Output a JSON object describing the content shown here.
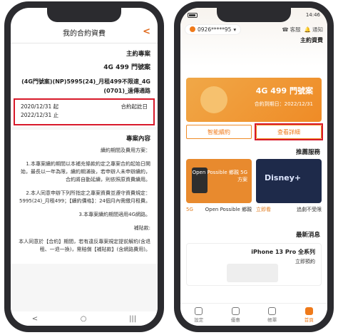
{
  "left": {
    "back_glyph": "<",
    "title": "我的合約資費",
    "section_main": "主約專案",
    "plan_name": "4G 499 門號案",
    "plan_desc": "(4G門號案)(NP)5995(24)_月租499不限速_4G (0701)_遠傳通路",
    "contract_label": "合約起訖日",
    "contract_start": "2020/12/31 起",
    "contract_end": "2022/12/31 止",
    "section_content": "專案內容",
    "para1": "續約期間及費用方案：",
    "para2": "1.本專案續約期間以本補充條款約定之專案合約起始日開始，最長以一年為限，續約期滿後，若申辦人未申辦續約，合約將自動延續，則依照原資費續用。",
    "para3": "2.本人同意申辦下列所指定之專案資費並遵守資費規定：5995(24)_月租499；【續約價格】：24個月內需繳月租費。",
    "para4": "3.本專案續約期間適用4G網路。",
    "para5": "補貼款:",
    "para6": "本人同意於【合約】期間，若有違反專案規定提前解約(含退租、一退一換)，需賠償【補貼款】(含網路費用)。",
    "home_back": "<",
    "home_menu": "|||",
    "home_circle": "○"
  },
  "right": {
    "time": "14:46",
    "account": "0926*****95",
    "chevron": "▾",
    "tool_service": "客服",
    "tool_notify": "通知",
    "contract_label": "主約資費",
    "banner_plan": "4G 499 門號案",
    "banner_date": "合約到期日：2022/12/31",
    "btn_detail": "查看詳細",
    "btn_renew": "智能續約",
    "recs_title": "推薦服務",
    "card_dark_logo": "Disney+",
    "card_orange_text": "Open Possible 鄉親\n5G 方案",
    "rec_label1": "追劇不受限",
    "rec_label1_action": "立即看",
    "rec_label2": "Open Possible 鄉親",
    "rec_label2_action": "5G",
    "news_title": "最新消息",
    "news_head": "iPhone 13 Pro 全系列",
    "news_sub": "立即預約",
    "tab_home": "首頁",
    "tab_msgs": "帳單",
    "tab_shop": "優惠",
    "tab_more": "設定"
  },
  "colors": {
    "accent": "#ef7a1a",
    "highlight_box": "#d8192a"
  }
}
